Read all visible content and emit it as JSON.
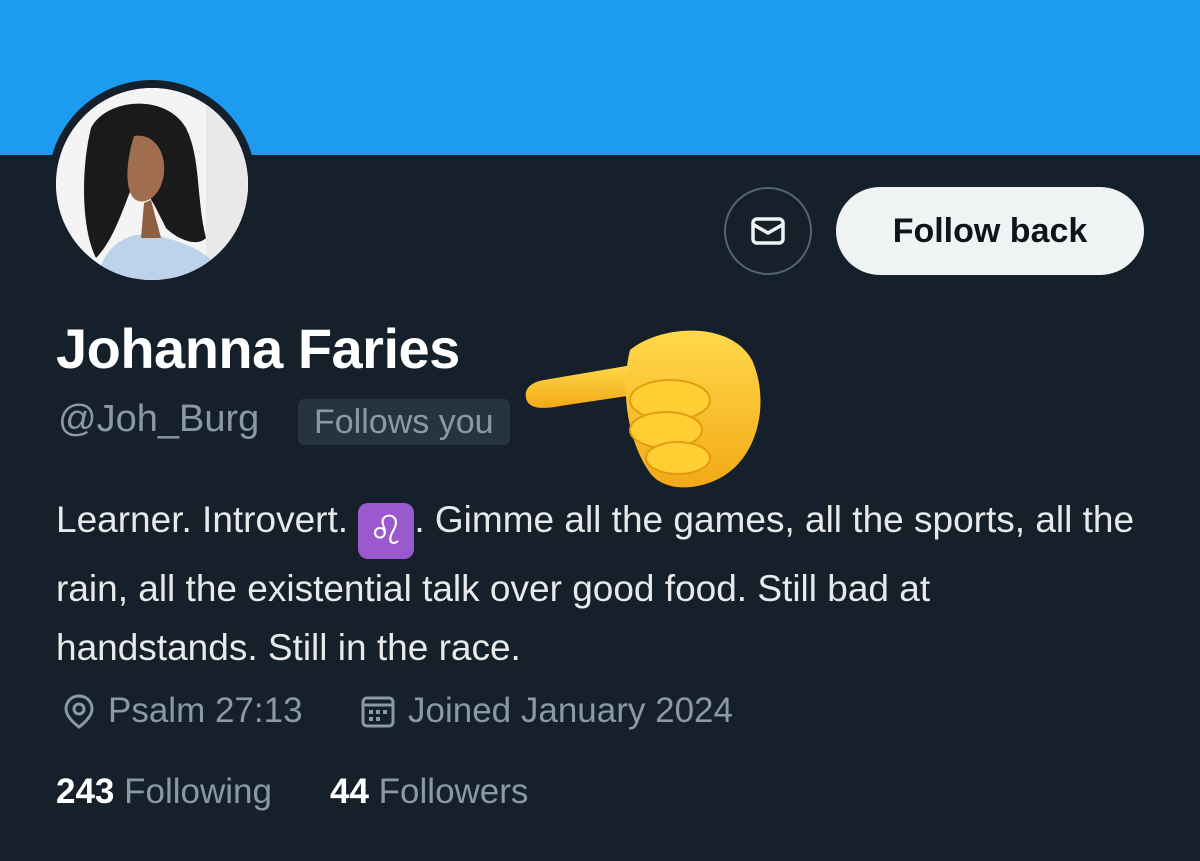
{
  "profile": {
    "name": "Johanna Faries",
    "handle": "@Joh_Burg",
    "follows_badge": "Follows you",
    "bio_part1": "Learner. Introvert. ",
    "zodiac": "♌",
    "bio_part2": ". Gimme all the games, all the sports, all the rain, all the existential talk over good food. Still bad at handstands. Still in the race.",
    "location": "Psalm 27:13",
    "joined": "Joined January 2024"
  },
  "actions": {
    "message_icon": "envelope-icon",
    "follow_back_label": "Follow back"
  },
  "stats": {
    "following_count": "243",
    "following_label": "Following",
    "followers_count": "44",
    "followers_label": "Followers"
  },
  "icons": {
    "location": "location-pin-icon",
    "calendar": "calendar-icon",
    "pointing": "pointing-hand-emoji"
  },
  "colors": {
    "banner": "#1d9bf0",
    "background": "#15202b",
    "secondary_text": "#8b98a5",
    "primary_text": "#e7e9ea"
  }
}
